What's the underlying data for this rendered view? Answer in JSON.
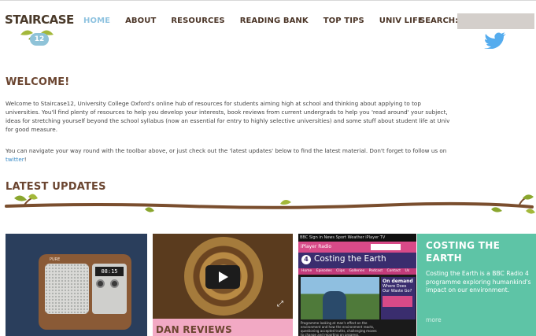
{
  "logo": {
    "text": "STAIRCASE",
    "badge": "12"
  },
  "nav": {
    "items": [
      {
        "label": "HOME",
        "active": true
      },
      {
        "label": "ABOUT",
        "active": false
      },
      {
        "label": "RESOURCES",
        "active": false
      },
      {
        "label": "READING BANK",
        "active": false
      },
      {
        "label": "TOP TIPS",
        "active": false
      },
      {
        "label": "UNIV LIFE",
        "active": false
      }
    ],
    "search_label": "SEARCH:",
    "search_value": "",
    "active_color": "#8fc3e0"
  },
  "welcome": {
    "title": "WELCOME!",
    "p1_lines": [
      "Welcome to Staircase12, University College Oxford's online hub of resources for students aiming high at school and thinking about applying to top",
      "universities. You'll find plenty of resources to help you develop your interests, book reviews from current undergrads to help you 'read around' your subject,",
      "ideas for stretching yourself beyond the school syllabus (now an essential for entry to highly selective universities) and some stuff about student life at Univ",
      "for good measure."
    ],
    "p2_line1": "You can navigate your way round with the toolbar above, or just check out the 'latest updates' below to find the latest material. Don't forget to follow us on",
    "p2_link": "twitter",
    "p2_end": "!"
  },
  "latest": {
    "title": "LATEST UPDATES"
  },
  "tiles": {
    "radio": {
      "display_time": "08:15",
      "brand": "PURE"
    },
    "dan": {
      "title": "DAN REVIEWS"
    },
    "iplayer": {
      "top_bar": "BBC  Sign in     News  Sport  Weather  iPlayer  TV",
      "header": "iPlayer Radio",
      "channel": "4",
      "title": "Costing the Earth",
      "tabs": "Home Episodes Clips Galleries Podcast Contact Us",
      "ondemand_title": "On demand",
      "ondemand_text": "Where Does Our Waste Go?",
      "caption": "Programme looking at man's effect on the environment and how the environment reacts, questioning accepted truths, challenging moves to change and reporting on progress."
    },
    "costing": {
      "title_line1": "COSTING THE",
      "title_line2": "EARTH",
      "description": "Costing the Earth is a BBC Radio 4 programme exploring humankind's impact on our environment.",
      "more": "more"
    }
  },
  "colors": {
    "brown_heading": "#6b4530",
    "teal_tile": "#5ec4a6",
    "pink_tile": "#f2a9c4",
    "twitter_blue": "#55acee",
    "link_blue": "#3a8cc8"
  }
}
